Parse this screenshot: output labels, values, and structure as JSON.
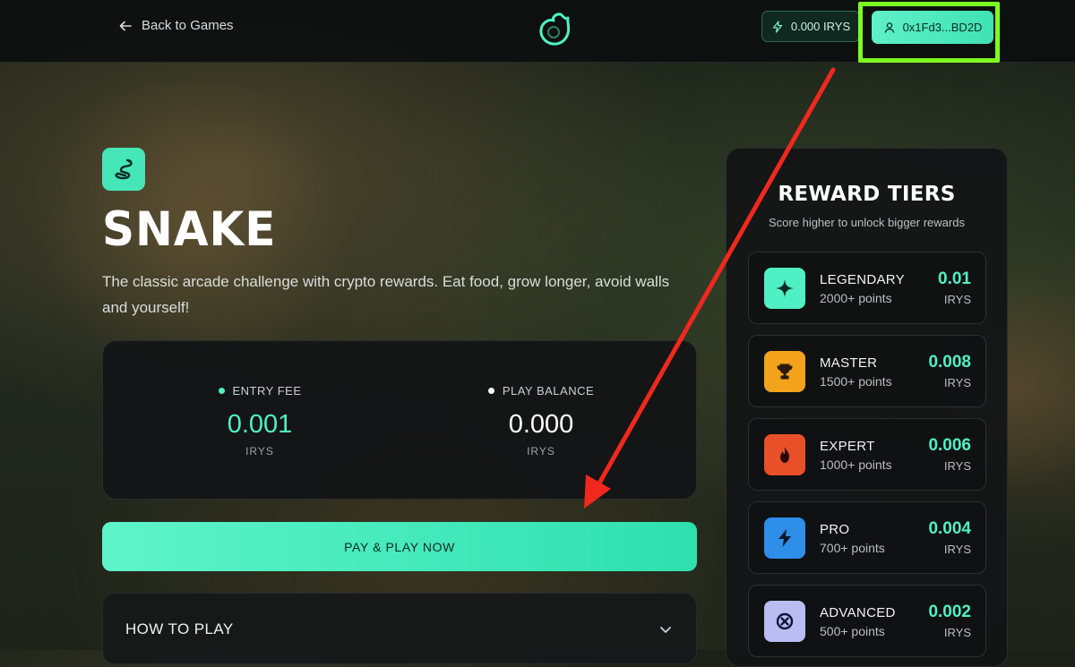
{
  "header": {
    "back_label": "Back to Games",
    "balance": "0.000 IRYS",
    "wallet": "0x1Fd3...BD2D"
  },
  "game": {
    "title": "SNAKE",
    "description": "The classic arcade challenge with crypto rewards. Eat food, grow longer, avoid walls and yourself!"
  },
  "fees": {
    "entry": {
      "label": "ENTRY FEE",
      "value": "0.001",
      "unit": "IRYS",
      "dot_color": "#4ff0c4",
      "value_color": "#4ff0c4"
    },
    "balance": {
      "label": "PLAY BALANCE",
      "value": "0.000",
      "unit": "IRYS",
      "dot_color": "#ffffff",
      "value_color": "#ffffff"
    }
  },
  "pay_button_label": "PAY & PLAY NOW",
  "howto_label": "HOW TO PLAY",
  "rewards": {
    "title": "REWARD TIERS",
    "subtitle": "Score higher to unlock bigger rewards",
    "tiers": [
      {
        "name": "LEGENDARY",
        "points": "2000+ points",
        "amount": "0.01",
        "unit": "IRYS",
        "icon": "sparkle-icon",
        "color": "#4ff0c4"
      },
      {
        "name": "MASTER",
        "points": "1500+ points",
        "amount": "0.008",
        "unit": "IRYS",
        "icon": "trophy-icon",
        "color": "#f2a31b"
      },
      {
        "name": "EXPERT",
        "points": "1000+ points",
        "amount": "0.006",
        "unit": "IRYS",
        "icon": "flame-icon",
        "color": "#e8502a"
      },
      {
        "name": "PRO",
        "points": "700+ points",
        "amount": "0.004",
        "unit": "IRYS",
        "icon": "lightning-icon",
        "color": "#2f8ee8"
      },
      {
        "name": "ADVANCED",
        "points": "500+ points",
        "amount": "0.002",
        "unit": "IRYS",
        "icon": "target-icon",
        "color": "#b9bdf2"
      }
    ]
  },
  "colors": {
    "accent": "#4ff0c4",
    "highlight_box": "#7cff1f",
    "annotation_arrow": "#f0281e"
  }
}
